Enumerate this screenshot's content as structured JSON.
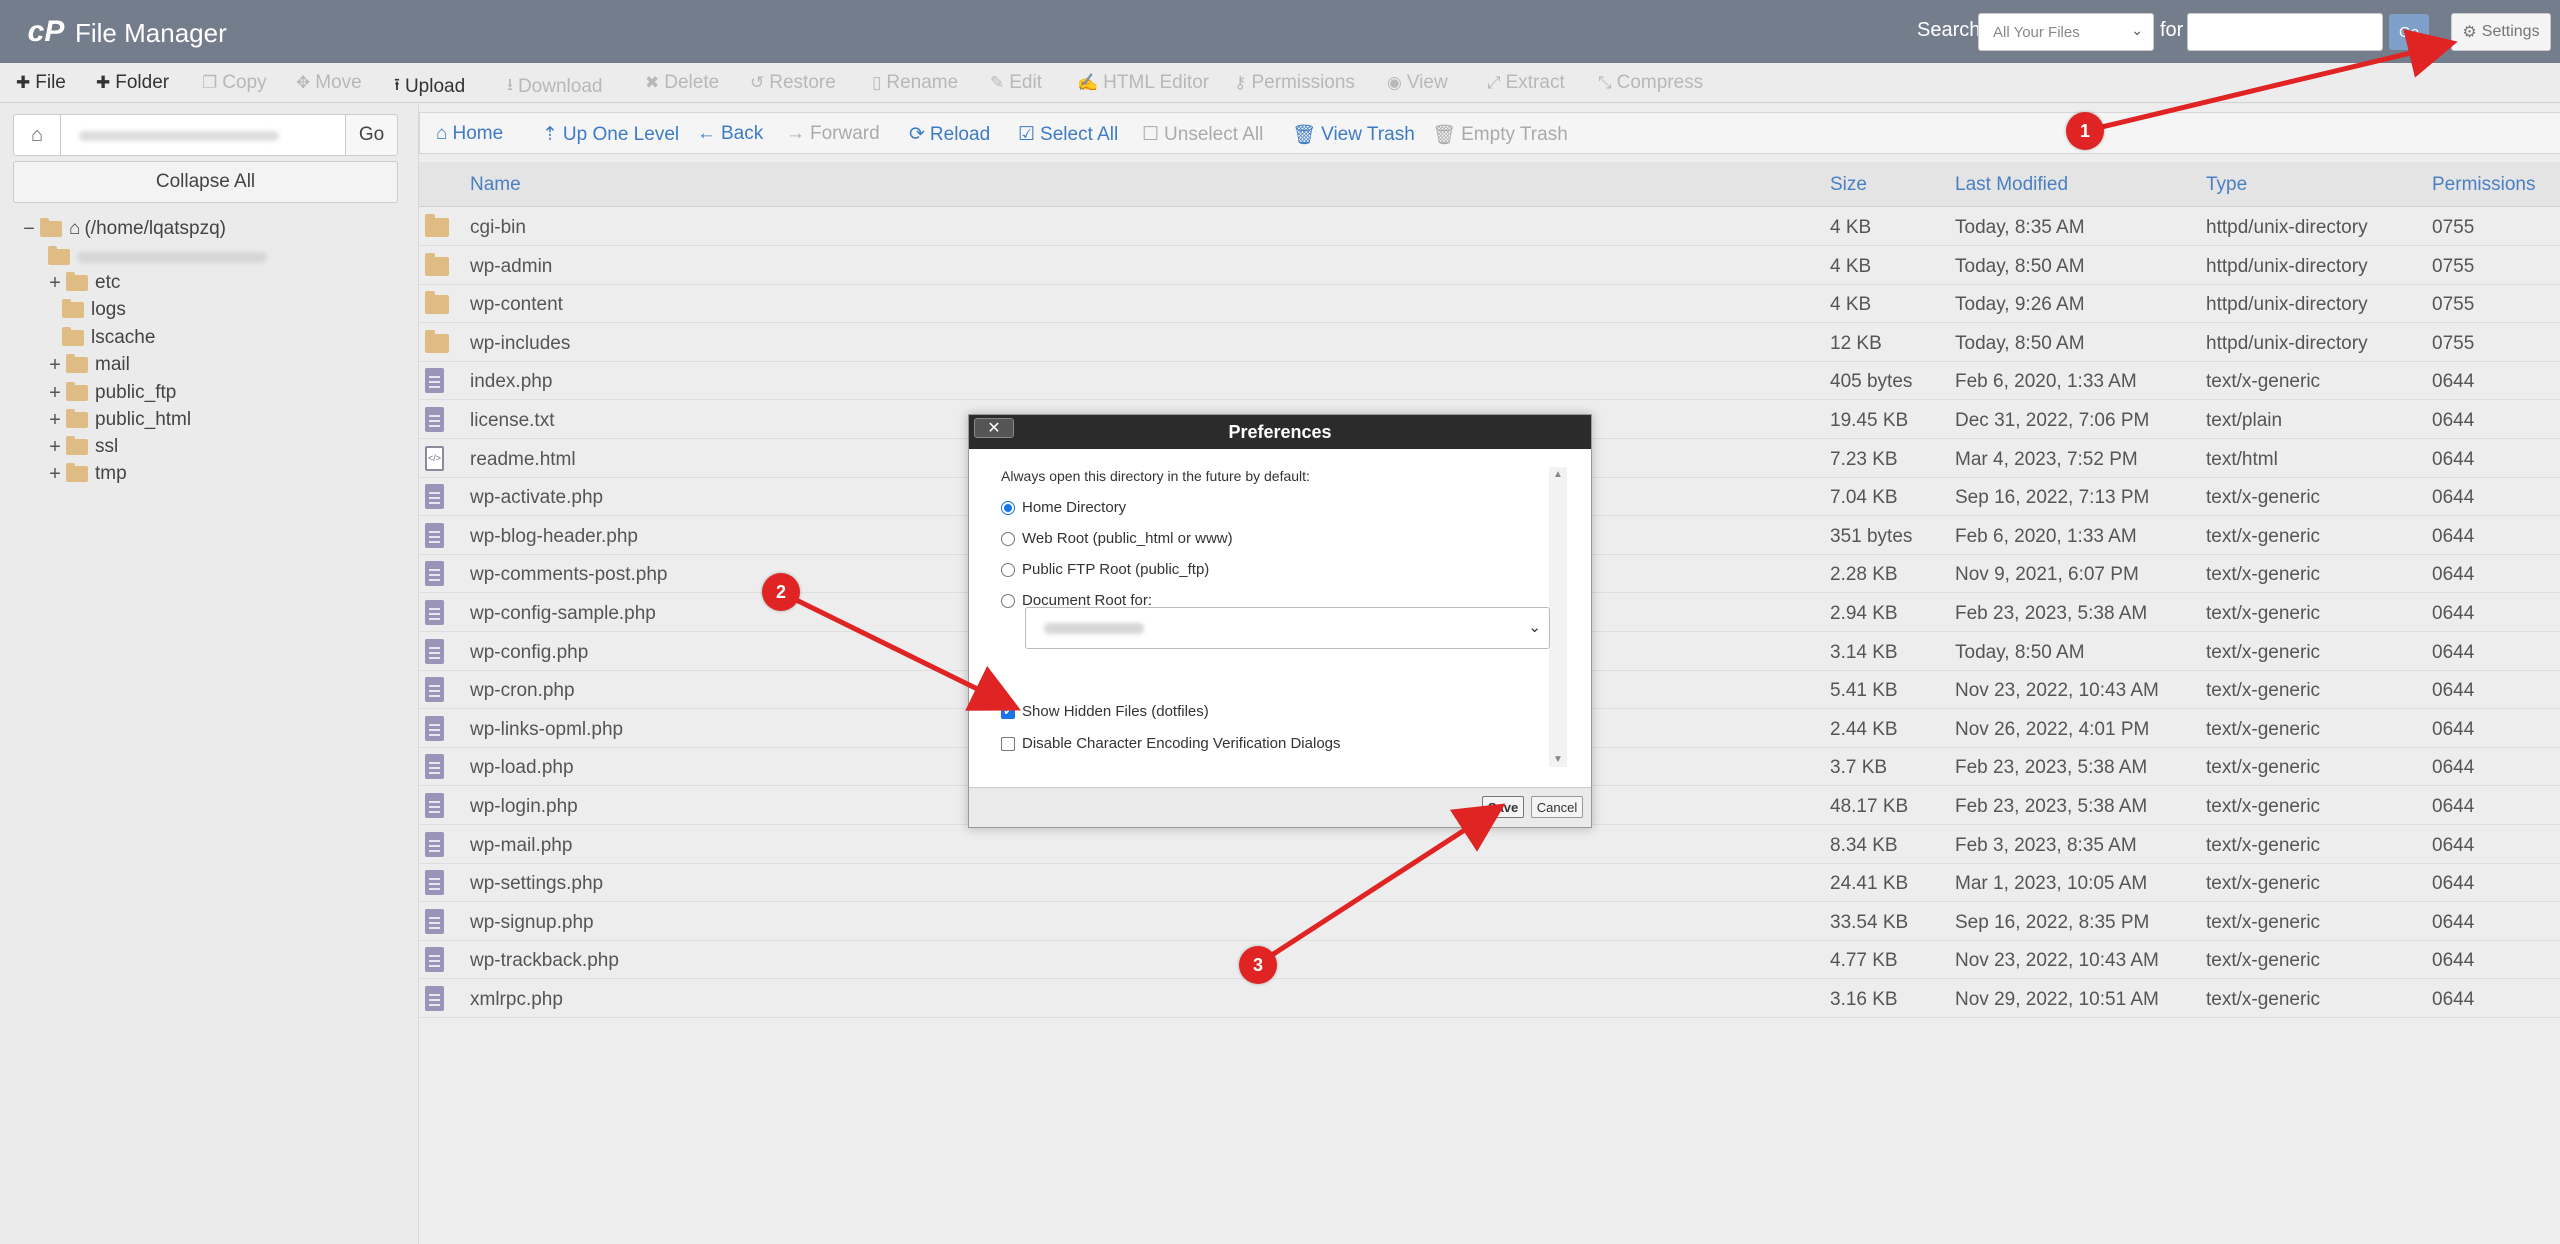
{
  "header": {
    "logo_text": "cP",
    "app_title": "File Manager",
    "search_label": "Search",
    "search_scope": "All Your Files",
    "for_label": "for",
    "search_value": "",
    "go_label": "Go",
    "settings_label": "Settings"
  },
  "toolbar": {
    "file": "File",
    "folder": "Folder",
    "copy": "Copy",
    "move": "Move",
    "upload": "Upload",
    "download": "Download",
    "delete": "Delete",
    "restore": "Restore",
    "rename": "Rename",
    "edit": "Edit",
    "html_editor": "HTML Editor",
    "permissions": "Permissions",
    "view": "View",
    "extract": "Extract",
    "compress": "Compress"
  },
  "sidebar": {
    "go_label": "Go",
    "collapse_label": "Collapse All",
    "root_label": "(/home/lqatspzq)",
    "items": [
      "etc",
      "logs",
      "lscache",
      "mail",
      "public_ftp",
      "public_html",
      "ssl",
      "tmp"
    ]
  },
  "navbar": {
    "home": "Home",
    "up": "Up One Level",
    "back": "Back",
    "forward": "Forward",
    "reload": "Reload",
    "select_all": "Select All",
    "unselect_all": "Unselect All",
    "view_trash": "View Trash",
    "empty_trash": "Empty Trash"
  },
  "table": {
    "columns": [
      "Name",
      "Size",
      "Last Modified",
      "Type",
      "Permissions"
    ],
    "rows": [
      {
        "name": "cgi-bin",
        "size": "4 KB",
        "modified": "Today, 8:35 AM",
        "type": "httpd/unix-directory",
        "perm": "0755",
        "icon": "folder"
      },
      {
        "name": "wp-admin",
        "size": "4 KB",
        "modified": "Today, 8:50 AM",
        "type": "httpd/unix-directory",
        "perm": "0755",
        "icon": "folder"
      },
      {
        "name": "wp-content",
        "size": "4 KB",
        "modified": "Today, 9:26 AM",
        "type": "httpd/unix-directory",
        "perm": "0755",
        "icon": "folder"
      },
      {
        "name": "wp-includes",
        "size": "12 KB",
        "modified": "Today, 8:50 AM",
        "type": "httpd/unix-directory",
        "perm": "0755",
        "icon": "folder"
      },
      {
        "name": "index.php",
        "size": "405 bytes",
        "modified": "Feb 6, 2020, 1:33 AM",
        "type": "text/x-generic",
        "perm": "0644",
        "icon": "file"
      },
      {
        "name": "license.txt",
        "size": "19.45 KB",
        "modified": "Dec 31, 2022, 7:06 PM",
        "type": "text/plain",
        "perm": "0644",
        "icon": "file"
      },
      {
        "name": "readme.html",
        "size": "7.23 KB",
        "modified": "Mar 4, 2023, 7:52 PM",
        "type": "text/html",
        "perm": "0644",
        "icon": "html"
      },
      {
        "name": "wp-activate.php",
        "size": "7.04 KB",
        "modified": "Sep 16, 2022, 7:13 PM",
        "type": "text/x-generic",
        "perm": "0644",
        "icon": "file"
      },
      {
        "name": "wp-blog-header.php",
        "size": "351 bytes",
        "modified": "Feb 6, 2020, 1:33 AM",
        "type": "text/x-generic",
        "perm": "0644",
        "icon": "file"
      },
      {
        "name": "wp-comments-post.php",
        "size": "2.28 KB",
        "modified": "Nov 9, 2021, 6:07 PM",
        "type": "text/x-generic",
        "perm": "0644",
        "icon": "file"
      },
      {
        "name": "wp-config-sample.php",
        "size": "2.94 KB",
        "modified": "Feb 23, 2023, 5:38 AM",
        "type": "text/x-generic",
        "perm": "0644",
        "icon": "file"
      },
      {
        "name": "wp-config.php",
        "size": "3.14 KB",
        "modified": "Today, 8:50 AM",
        "type": "text/x-generic",
        "perm": "0644",
        "icon": "file"
      },
      {
        "name": "wp-cron.php",
        "size": "5.41 KB",
        "modified": "Nov 23, 2022, 10:43 AM",
        "type": "text/x-generic",
        "perm": "0644",
        "icon": "file"
      },
      {
        "name": "wp-links-opml.php",
        "size": "2.44 KB",
        "modified": "Nov 26, 2022, 4:01 PM",
        "type": "text/x-generic",
        "perm": "0644",
        "icon": "file"
      },
      {
        "name": "wp-load.php",
        "size": "3.7 KB",
        "modified": "Feb 23, 2023, 5:38 AM",
        "type": "text/x-generic",
        "perm": "0644",
        "icon": "file"
      },
      {
        "name": "wp-login.php",
        "size": "48.17 KB",
        "modified": "Feb 23, 2023, 5:38 AM",
        "type": "text/x-generic",
        "perm": "0644",
        "icon": "file"
      },
      {
        "name": "wp-mail.php",
        "size": "8.34 KB",
        "modified": "Feb 3, 2023, 8:35 AM",
        "type": "text/x-generic",
        "perm": "0644",
        "icon": "file"
      },
      {
        "name": "wp-settings.php",
        "size": "24.41 KB",
        "modified": "Mar 1, 2023, 10:05 AM",
        "type": "text/x-generic",
        "perm": "0644",
        "icon": "file"
      },
      {
        "name": "wp-signup.php",
        "size": "33.54 KB",
        "modified": "Sep 16, 2022, 8:35 PM",
        "type": "text/x-generic",
        "perm": "0644",
        "icon": "file"
      },
      {
        "name": "wp-trackback.php",
        "size": "4.77 KB",
        "modified": "Nov 23, 2022, 10:43 AM",
        "type": "text/x-generic",
        "perm": "0644",
        "icon": "file"
      },
      {
        "name": "xmlrpc.php",
        "size": "3.16 KB",
        "modified": "Nov 29, 2022, 10:51 AM",
        "type": "text/x-generic",
        "perm": "0644",
        "icon": "file"
      }
    ]
  },
  "preferences": {
    "title": "Preferences",
    "close": "✕",
    "intro": "Always open this directory in the future by default:",
    "home_dir": "Home Directory",
    "web_root": "Web Root (public_html or www)",
    "public_ftp": "Public FTP Root (public_ftp)",
    "doc_root": "Document Root for:",
    "show_hidden": "Show Hidden Files (dotfiles)",
    "disable_encoding": "Disable Character Encoding Verification Dialogs",
    "save": "Save",
    "cancel": "Cancel"
  },
  "annotations": {
    "step1": "1",
    "step2": "2",
    "step3": "3"
  },
  "colors": {
    "header_bg": "#747d8c",
    "link_blue": "#3d7bc7",
    "folder_tan": "#dfbc83",
    "annotation_red": "#e02323"
  }
}
